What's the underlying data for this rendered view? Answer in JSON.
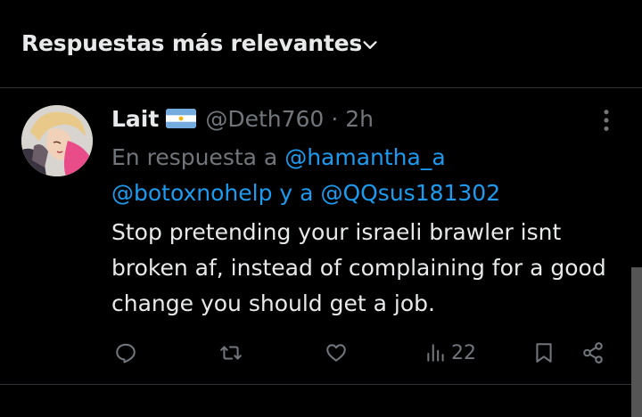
{
  "sort": {
    "label": "Respuestas más relevantes"
  },
  "tweet": {
    "display_name": "Lait",
    "handle": "@Deth760",
    "separator": "·",
    "time": "2h",
    "reply_prefix": "En respuesta a",
    "mention_1": "@hamantha_a",
    "mention_2": "@botoxnohelp",
    "reply_join": "y a",
    "mention_3": "@QQsus181302",
    "text": "Stop pretending your israeli brawler isnt broken af, instead of complaining for a good change you should get a job.",
    "views": "22"
  },
  "colors": {
    "background": "#000000",
    "text": "#e7e9ea",
    "muted": "#71767b",
    "link": "#1d9bf0",
    "divider": "#2f3336"
  },
  "icons": [
    "chevron-down-icon",
    "flag-argentina-icon",
    "more-icon",
    "reply-icon",
    "retweet-icon",
    "like-icon",
    "views-icon",
    "bookmark-icon",
    "share-icon"
  ]
}
